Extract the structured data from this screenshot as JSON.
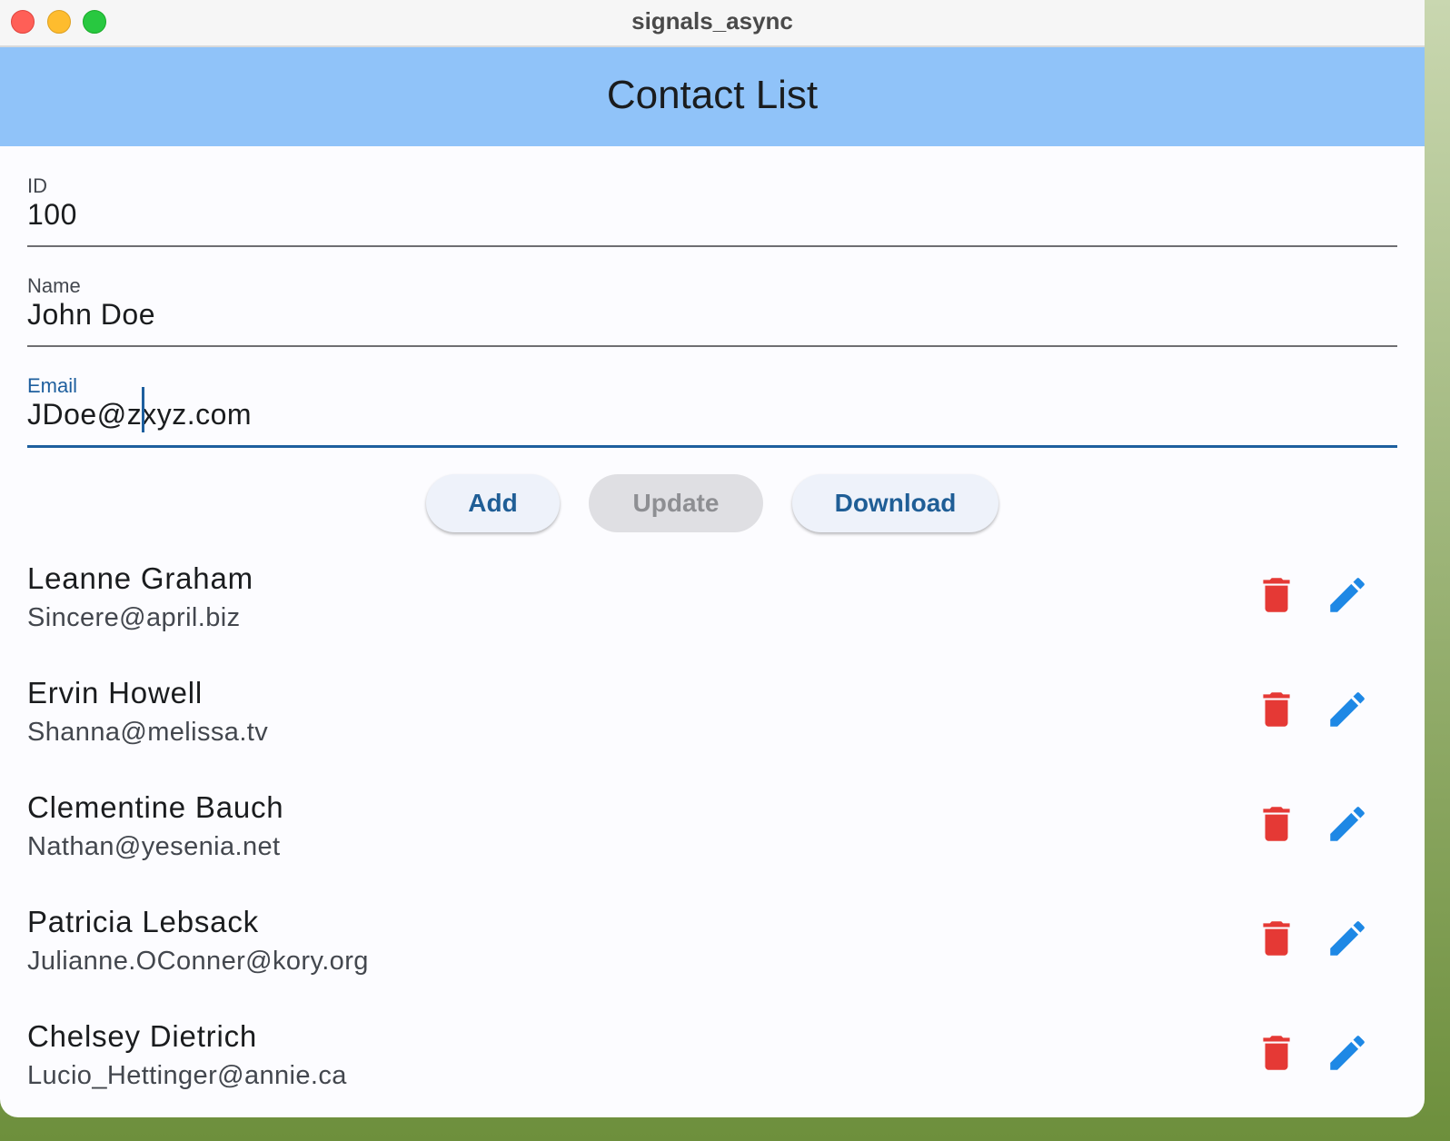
{
  "window": {
    "title": "signals_async"
  },
  "appbar": {
    "title": "Contact List",
    "color": "#90c3f9"
  },
  "form": {
    "id": {
      "label": "ID",
      "value": "100"
    },
    "name": {
      "label": "Name",
      "value": "John Doe"
    },
    "email": {
      "label": "Email",
      "value": "JDoe@zxyz.com"
    }
  },
  "buttons": {
    "add": "Add",
    "update": "Update",
    "download": "Download"
  },
  "contacts": [
    {
      "name": "Leanne Graham",
      "email": "Sincere@april.biz"
    },
    {
      "name": "Ervin Howell",
      "email": "Shanna@melissa.tv"
    },
    {
      "name": "Clementine Bauch",
      "email": "Nathan@yesenia.net"
    },
    {
      "name": "Patricia Lebsack",
      "email": "Julianne.OConner@kory.org"
    },
    {
      "name": "Chelsey Dietrich",
      "email": "Lucio_Hettinger@annie.ca"
    }
  ],
  "icons": {
    "delete": "trash-icon",
    "edit": "pencil-icon",
    "delete_color": "#e53935",
    "edit_color": "#1e88e5"
  }
}
